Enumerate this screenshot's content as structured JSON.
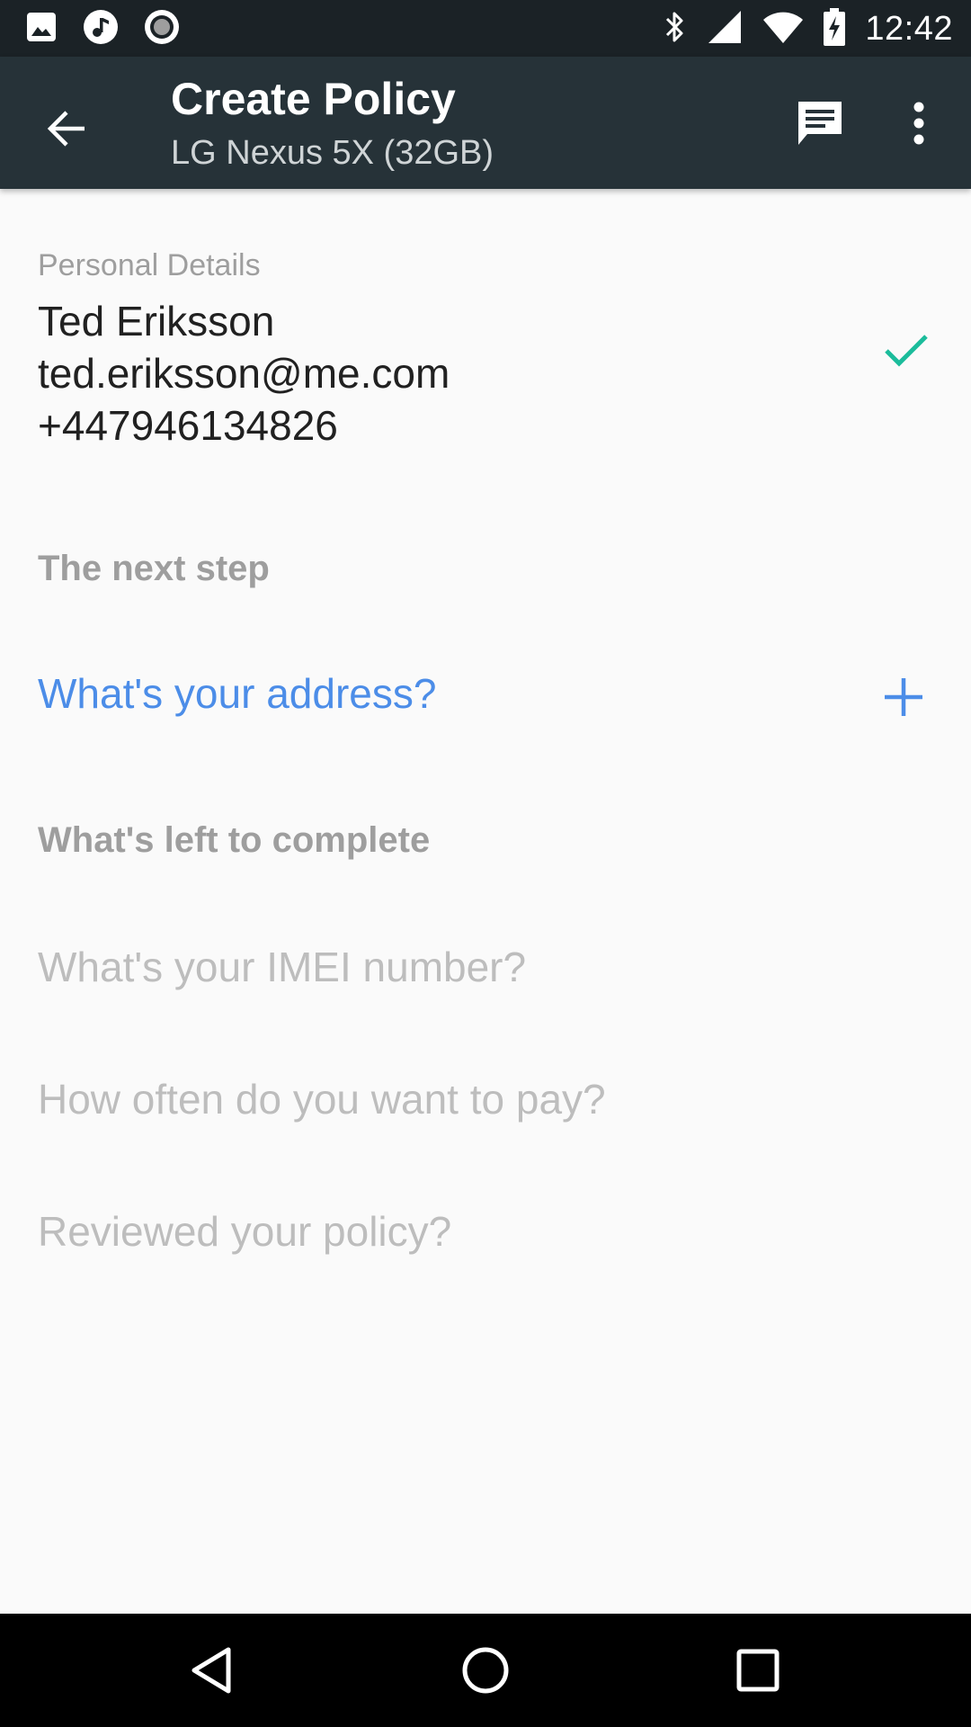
{
  "status_bar": {
    "time": "12:42",
    "left_icons": [
      "image-icon",
      "music-note-icon",
      "record-icon"
    ],
    "right_icons": [
      "bluetooth-icon",
      "cell-signal-icon",
      "wifi-icon",
      "battery-charging-icon"
    ]
  },
  "app_bar": {
    "title": "Create Policy",
    "subtitle": "LG Nexus 5X (32GB)",
    "icons": {
      "back": "arrow-back-icon",
      "chat": "chat-icon",
      "more": "more-vert-icon"
    }
  },
  "personal_details": {
    "label": "Personal Details",
    "name": "Ted Eriksson",
    "email": "ted.eriksson@me.com",
    "phone": "+447946134826",
    "status_icon": "check-icon"
  },
  "next_step": {
    "heading": "The next step",
    "item": "What's your address?",
    "action_icon": "plus-icon"
  },
  "remaining": {
    "heading": "What's left to complete",
    "items": [
      "What's your IMEI number?",
      "How often do you want to pay?",
      "Reviewed your policy?"
    ]
  },
  "nav_bar": {
    "icons": [
      "back-triangle-icon",
      "home-circle-icon",
      "recents-square-icon"
    ]
  },
  "colors": {
    "status_bar": "#1B2226",
    "app_bar": "#263238",
    "background": "#FAFAFA",
    "accent_blue": "#4C8DE8",
    "check_teal": "#1BBC9B",
    "muted_text": "#9E9E9E",
    "disabled_text": "#BDBDBD"
  }
}
